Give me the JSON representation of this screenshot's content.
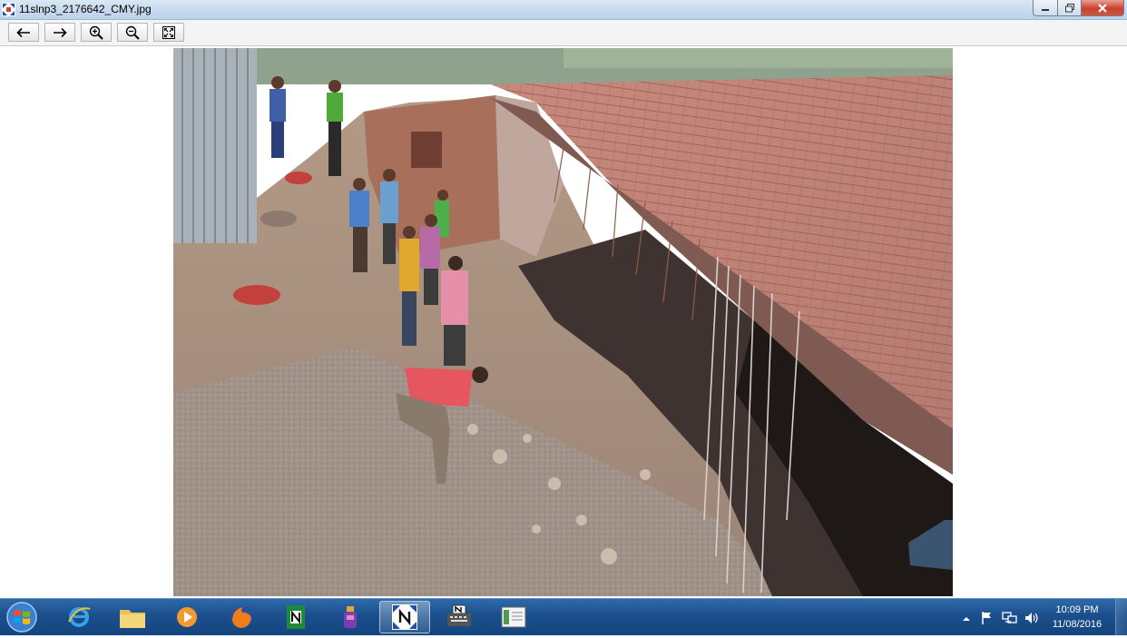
{
  "window": {
    "title": "11slnp3_2176642_CMY.jpg",
    "controls": [
      "minimize",
      "maximize",
      "close"
    ]
  },
  "toolbar": {
    "buttons": [
      {
        "name": "previous",
        "icon": "arrow-left-icon"
      },
      {
        "name": "next",
        "icon": "arrow-right-icon"
      },
      {
        "name": "zoom-in",
        "icon": "zoom-in-icon"
      },
      {
        "name": "zoom-out",
        "icon": "zoom-out-icon"
      },
      {
        "name": "fit-to-window",
        "icon": "fit-window-icon"
      }
    ]
  },
  "image": {
    "subject": "construction-site-photo"
  },
  "taskbar": {
    "apps": [
      {
        "name": "internet-explorer",
        "icon": "ie-icon"
      },
      {
        "name": "file-explorer",
        "icon": "folder-icon"
      },
      {
        "name": "media-player",
        "icon": "media-play-icon"
      },
      {
        "name": "firefox",
        "icon": "firefox-icon"
      },
      {
        "name": "nitro-app",
        "icon": "n-app-icon"
      },
      {
        "name": "ink-app",
        "icon": "ink-bottle-icon"
      },
      {
        "name": "image-viewer",
        "icon": "n-expand-icon",
        "active": true
      },
      {
        "name": "typewriter-app",
        "icon": "typewriter-icon"
      },
      {
        "name": "notebook-app",
        "icon": "notebook-icon"
      }
    ],
    "clock": {
      "time": "10:09 PM",
      "date": "11/08/2016"
    },
    "colors": {
      "bar": "#1b4f8c",
      "accent": "#2f6aa8"
    }
  }
}
